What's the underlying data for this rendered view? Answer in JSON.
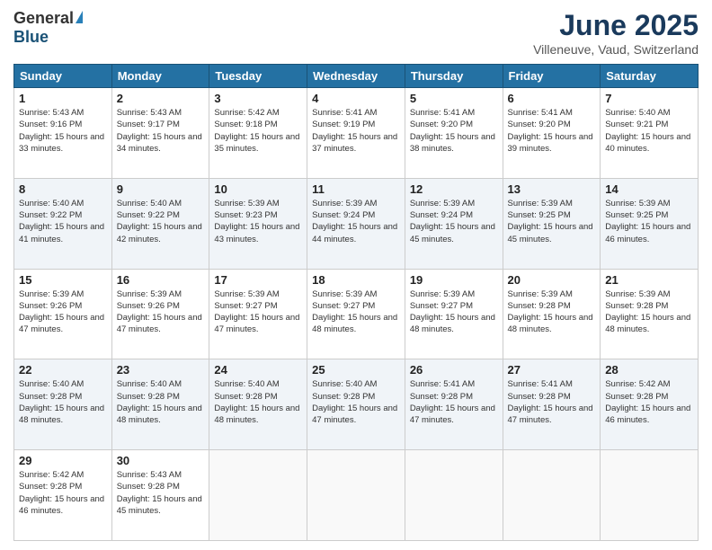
{
  "header": {
    "logo_general": "General",
    "logo_blue": "Blue",
    "month_title": "June 2025",
    "location": "Villeneuve, Vaud, Switzerland"
  },
  "calendar": {
    "headers": [
      "Sunday",
      "Monday",
      "Tuesday",
      "Wednesday",
      "Thursday",
      "Friday",
      "Saturday"
    ],
    "weeks": [
      [
        null,
        {
          "day": "2",
          "sunrise": "5:43 AM",
          "sunset": "9:17 PM",
          "daylight": "15 hours and 34 minutes."
        },
        {
          "day": "3",
          "sunrise": "5:42 AM",
          "sunset": "9:18 PM",
          "daylight": "15 hours and 35 minutes."
        },
        {
          "day": "4",
          "sunrise": "5:41 AM",
          "sunset": "9:19 PM",
          "daylight": "15 hours and 37 minutes."
        },
        {
          "day": "5",
          "sunrise": "5:41 AM",
          "sunset": "9:20 PM",
          "daylight": "15 hours and 38 minutes."
        },
        {
          "day": "6",
          "sunrise": "5:41 AM",
          "sunset": "9:20 PM",
          "daylight": "15 hours and 39 minutes."
        },
        {
          "day": "7",
          "sunrise": "5:40 AM",
          "sunset": "9:21 PM",
          "daylight": "15 hours and 40 minutes."
        }
      ],
      [
        {
          "day": "1",
          "sunrise": "5:43 AM",
          "sunset": "9:16 PM",
          "daylight": "15 hours and 33 minutes."
        },
        {
          "day": "8",
          "sunrise": "5:40 AM",
          "sunset": "9:22 PM",
          "daylight": "15 hours and 41 minutes."
        },
        {
          "day": "9",
          "sunrise": "5:40 AM",
          "sunset": "9:22 PM",
          "daylight": "15 hours and 42 minutes."
        },
        {
          "day": "10",
          "sunrise": "5:39 AM",
          "sunset": "9:23 PM",
          "daylight": "15 hours and 43 minutes."
        },
        {
          "day": "11",
          "sunrise": "5:39 AM",
          "sunset": "9:24 PM",
          "daylight": "15 hours and 44 minutes."
        },
        {
          "day": "12",
          "sunrise": "5:39 AM",
          "sunset": "9:24 PM",
          "daylight": "15 hours and 45 minutes."
        },
        {
          "day": "13",
          "sunrise": "5:39 AM",
          "sunset": "9:25 PM",
          "daylight": "15 hours and 45 minutes."
        },
        {
          "day": "14",
          "sunrise": "5:39 AM",
          "sunset": "9:25 PM",
          "daylight": "15 hours and 46 minutes."
        }
      ],
      [
        {
          "day": "15",
          "sunrise": "5:39 AM",
          "sunset": "9:26 PM",
          "daylight": "15 hours and 47 minutes."
        },
        {
          "day": "16",
          "sunrise": "5:39 AM",
          "sunset": "9:26 PM",
          "daylight": "15 hours and 47 minutes."
        },
        {
          "day": "17",
          "sunrise": "5:39 AM",
          "sunset": "9:27 PM",
          "daylight": "15 hours and 47 minutes."
        },
        {
          "day": "18",
          "sunrise": "5:39 AM",
          "sunset": "9:27 PM",
          "daylight": "15 hours and 48 minutes."
        },
        {
          "day": "19",
          "sunrise": "5:39 AM",
          "sunset": "9:27 PM",
          "daylight": "15 hours and 48 minutes."
        },
        {
          "day": "20",
          "sunrise": "5:39 AM",
          "sunset": "9:28 PM",
          "daylight": "15 hours and 48 minutes."
        },
        {
          "day": "21",
          "sunrise": "5:39 AM",
          "sunset": "9:28 PM",
          "daylight": "15 hours and 48 minutes."
        }
      ],
      [
        {
          "day": "22",
          "sunrise": "5:40 AM",
          "sunset": "9:28 PM",
          "daylight": "15 hours and 48 minutes."
        },
        {
          "day": "23",
          "sunrise": "5:40 AM",
          "sunset": "9:28 PM",
          "daylight": "15 hours and 48 minutes."
        },
        {
          "day": "24",
          "sunrise": "5:40 AM",
          "sunset": "9:28 PM",
          "daylight": "15 hours and 48 minutes."
        },
        {
          "day": "25",
          "sunrise": "5:40 AM",
          "sunset": "9:28 PM",
          "daylight": "15 hours and 47 minutes."
        },
        {
          "day": "26",
          "sunrise": "5:41 AM",
          "sunset": "9:28 PM",
          "daylight": "15 hours and 47 minutes."
        },
        {
          "day": "27",
          "sunrise": "5:41 AM",
          "sunset": "9:28 PM",
          "daylight": "15 hours and 47 minutes."
        },
        {
          "day": "28",
          "sunrise": "5:42 AM",
          "sunset": "9:28 PM",
          "daylight": "15 hours and 46 minutes."
        }
      ],
      [
        {
          "day": "29",
          "sunrise": "5:42 AM",
          "sunset": "9:28 PM",
          "daylight": "15 hours and 46 minutes."
        },
        {
          "day": "30",
          "sunrise": "5:43 AM",
          "sunset": "9:28 PM",
          "daylight": "15 hours and 45 minutes."
        },
        null,
        null,
        null,
        null,
        null
      ]
    ]
  }
}
